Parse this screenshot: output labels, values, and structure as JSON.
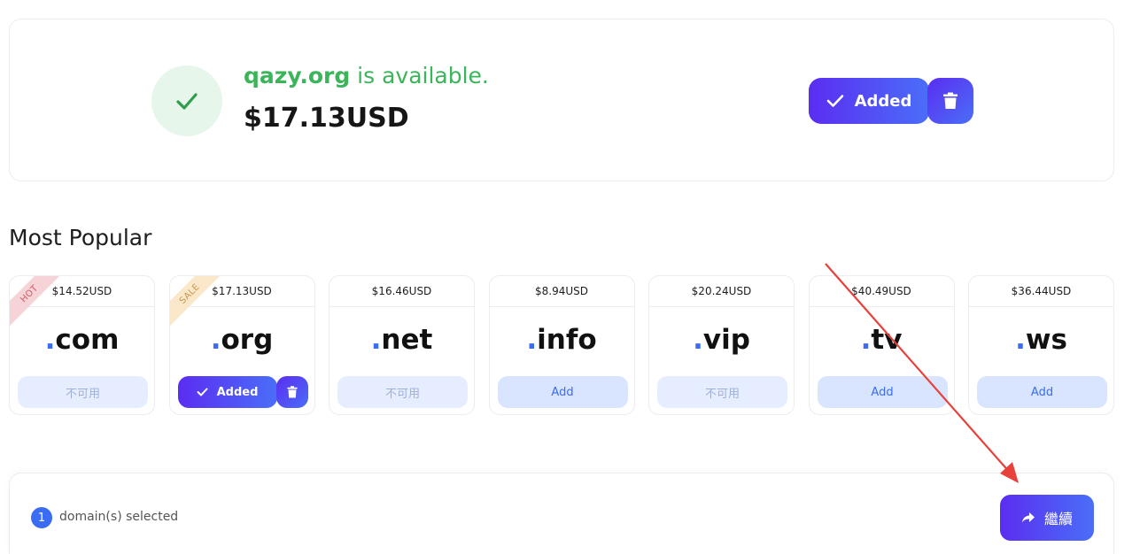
{
  "result": {
    "domain": "qazy.org",
    "status_text": " is available.",
    "price": "$17.13USD",
    "added_label": "Added"
  },
  "popular": {
    "title": "Most Popular",
    "tlds": [
      {
        "tld": "com",
        "price": "$14.52USD",
        "ribbon": "HOT",
        "state": "unavailable",
        "button_label": "不可用"
      },
      {
        "tld": "org",
        "price": "$17.13USD",
        "ribbon": "SALE",
        "state": "added",
        "button_label": "Added"
      },
      {
        "tld": "net",
        "price": "$16.46USD",
        "ribbon": "",
        "state": "unavailable",
        "button_label": "不可用"
      },
      {
        "tld": "info",
        "price": "$8.94USD",
        "ribbon": "",
        "state": "add",
        "button_label": "Add"
      },
      {
        "tld": "vip",
        "price": "$20.24USD",
        "ribbon": "",
        "state": "unavailable",
        "button_label": "不可用"
      },
      {
        "tld": "tv",
        "price": "$40.49USD",
        "ribbon": "",
        "state": "add",
        "button_label": "Add"
      },
      {
        "tld": "ws",
        "price": "$36.44USD",
        "ribbon": "",
        "state": "add",
        "button_label": "Add"
      }
    ]
  },
  "footer": {
    "selected_count": "1",
    "selected_text": "domain(s) selected",
    "continue_label": "繼續"
  },
  "colors": {
    "accent_start": "#5b2df1",
    "accent_end": "#4a6ef8",
    "available_green": "#3cb55a",
    "tld_dot": "#3a6cf4",
    "annotation_red": "#e8403a"
  },
  "icons": {
    "success": "check-icon",
    "remove": "trash-icon",
    "continue": "share-arrow-icon"
  }
}
